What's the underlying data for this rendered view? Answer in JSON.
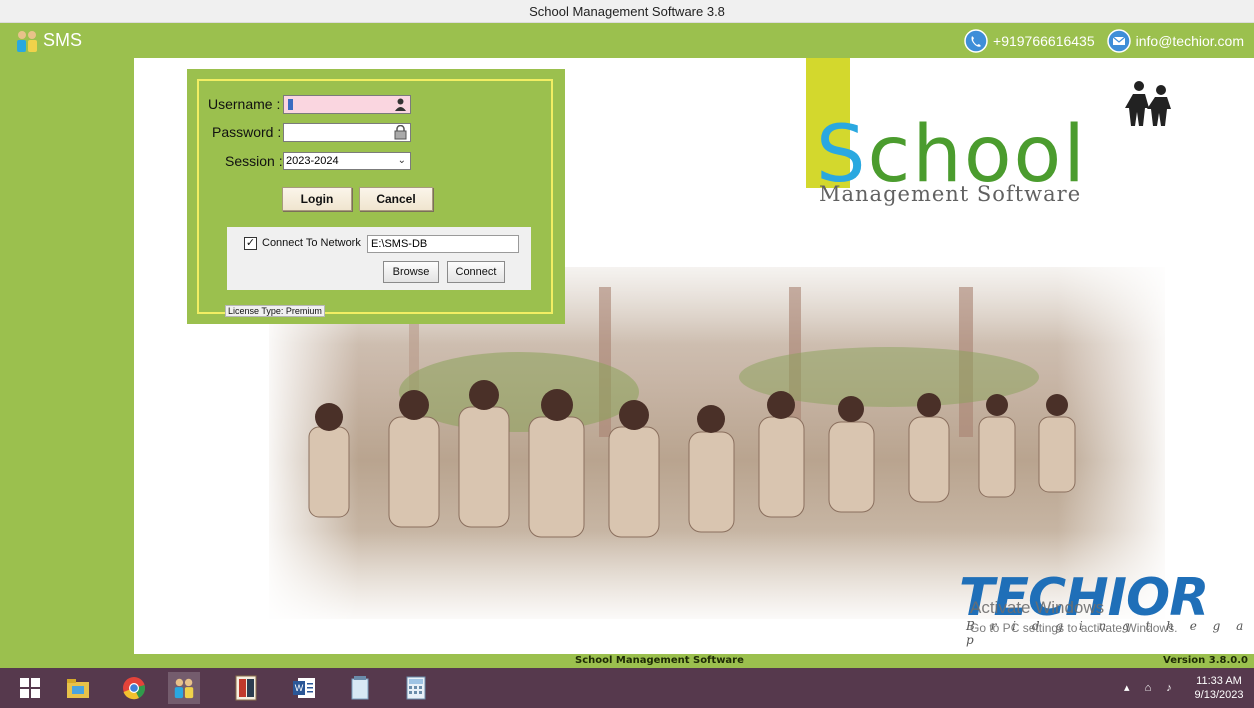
{
  "window": {
    "title": "School Management Software 3.8"
  },
  "header": {
    "app_name": "SMS",
    "phone": "+919766616435",
    "email": "info@techior.com"
  },
  "login": {
    "username_label": "Username :",
    "username_value": "",
    "password_label": "Password :",
    "password_value": "",
    "session_label": "Session :",
    "session_value": "2023-2024",
    "login_button": "Login",
    "cancel_button": "Cancel",
    "network": {
      "checkbox_label": "Connect To Network",
      "checked": true,
      "path_value": "E:\\SMS-DB",
      "browse_button": "Browse",
      "connect_button": "Connect"
    },
    "license": "License Type: Premium"
  },
  "branding": {
    "school_first": "S",
    "school_rest": "chool",
    "school_sub": "Management Software",
    "company": "TECHIOR",
    "company_tag": "B r i d g i n g   t h e   g a p",
    "watermark_title": "Activate Windows",
    "watermark_sub": "Go to PC settings to activate Windows."
  },
  "footer": {
    "center": "School Management Software",
    "version": "Version 3.8.0.0"
  },
  "taskbar": {
    "time": "11:33 AM",
    "date": "9/13/2023",
    "apps": [
      "windows-start",
      "file-explorer",
      "chrome",
      "sms-app",
      "tally-erp",
      "word",
      "notepad",
      "calculator"
    ]
  },
  "colors": {
    "brand_green": "#9bc04e",
    "accent_yellow": "#f1ee63",
    "school_blue": "#2aa8e0",
    "school_green": "#4b9c2e",
    "techior_blue": "#1f6fb8",
    "taskbar": "#56394d"
  }
}
